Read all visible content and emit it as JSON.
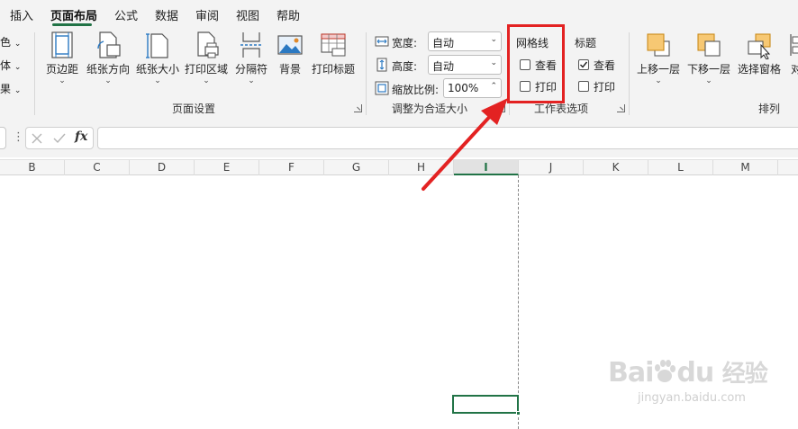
{
  "menu": {
    "tabs": [
      "插入",
      "页面布局",
      "公式",
      "数据",
      "审阅",
      "视图",
      "帮助"
    ],
    "active": "页面布局"
  },
  "ribbon": {
    "left_partial": [
      "色",
      "体",
      "果"
    ],
    "page_setup": {
      "buttons": [
        "页边距",
        "纸张方向",
        "纸张大小",
        "打印区域",
        "分隔符",
        "背景",
        "打印标题"
      ],
      "label": "页面设置"
    },
    "scale_to_fit": {
      "width_label": "宽度:",
      "width_value": "自动",
      "height_label": "高度:",
      "height_value": "自动",
      "scale_label": "缩放比例:",
      "scale_value": "100%",
      "label": "调整为合适大小"
    },
    "sheet_options": {
      "gridlines_title": "网格线",
      "gridlines_view": "查看",
      "gridlines_view_checked": false,
      "gridlines_print": "打印",
      "gridlines_print_checked": false,
      "headings_title": "标题",
      "headings_view": "查看",
      "headings_view_checked": true,
      "headings_print": "打印",
      "headings_print_checked": false,
      "label": "工作表选项"
    },
    "arrange": {
      "buttons": [
        "上移一层",
        "下移一层",
        "选择窗格",
        "对"
      ],
      "label": "排列"
    }
  },
  "formula_bar": {
    "fx": "fx",
    "value": ""
  },
  "columns": [
    "B",
    "C",
    "D",
    "E",
    "F",
    "G",
    "H",
    "I",
    "J",
    "K",
    "L",
    "M"
  ],
  "selected_column": "I",
  "watermark": {
    "brand": "Bai",
    "brand2": "du",
    "cn": "经验",
    "url": "jingyan.baidu.com"
  },
  "colors": {
    "accent": "#217346",
    "highlight": "#e32222"
  }
}
